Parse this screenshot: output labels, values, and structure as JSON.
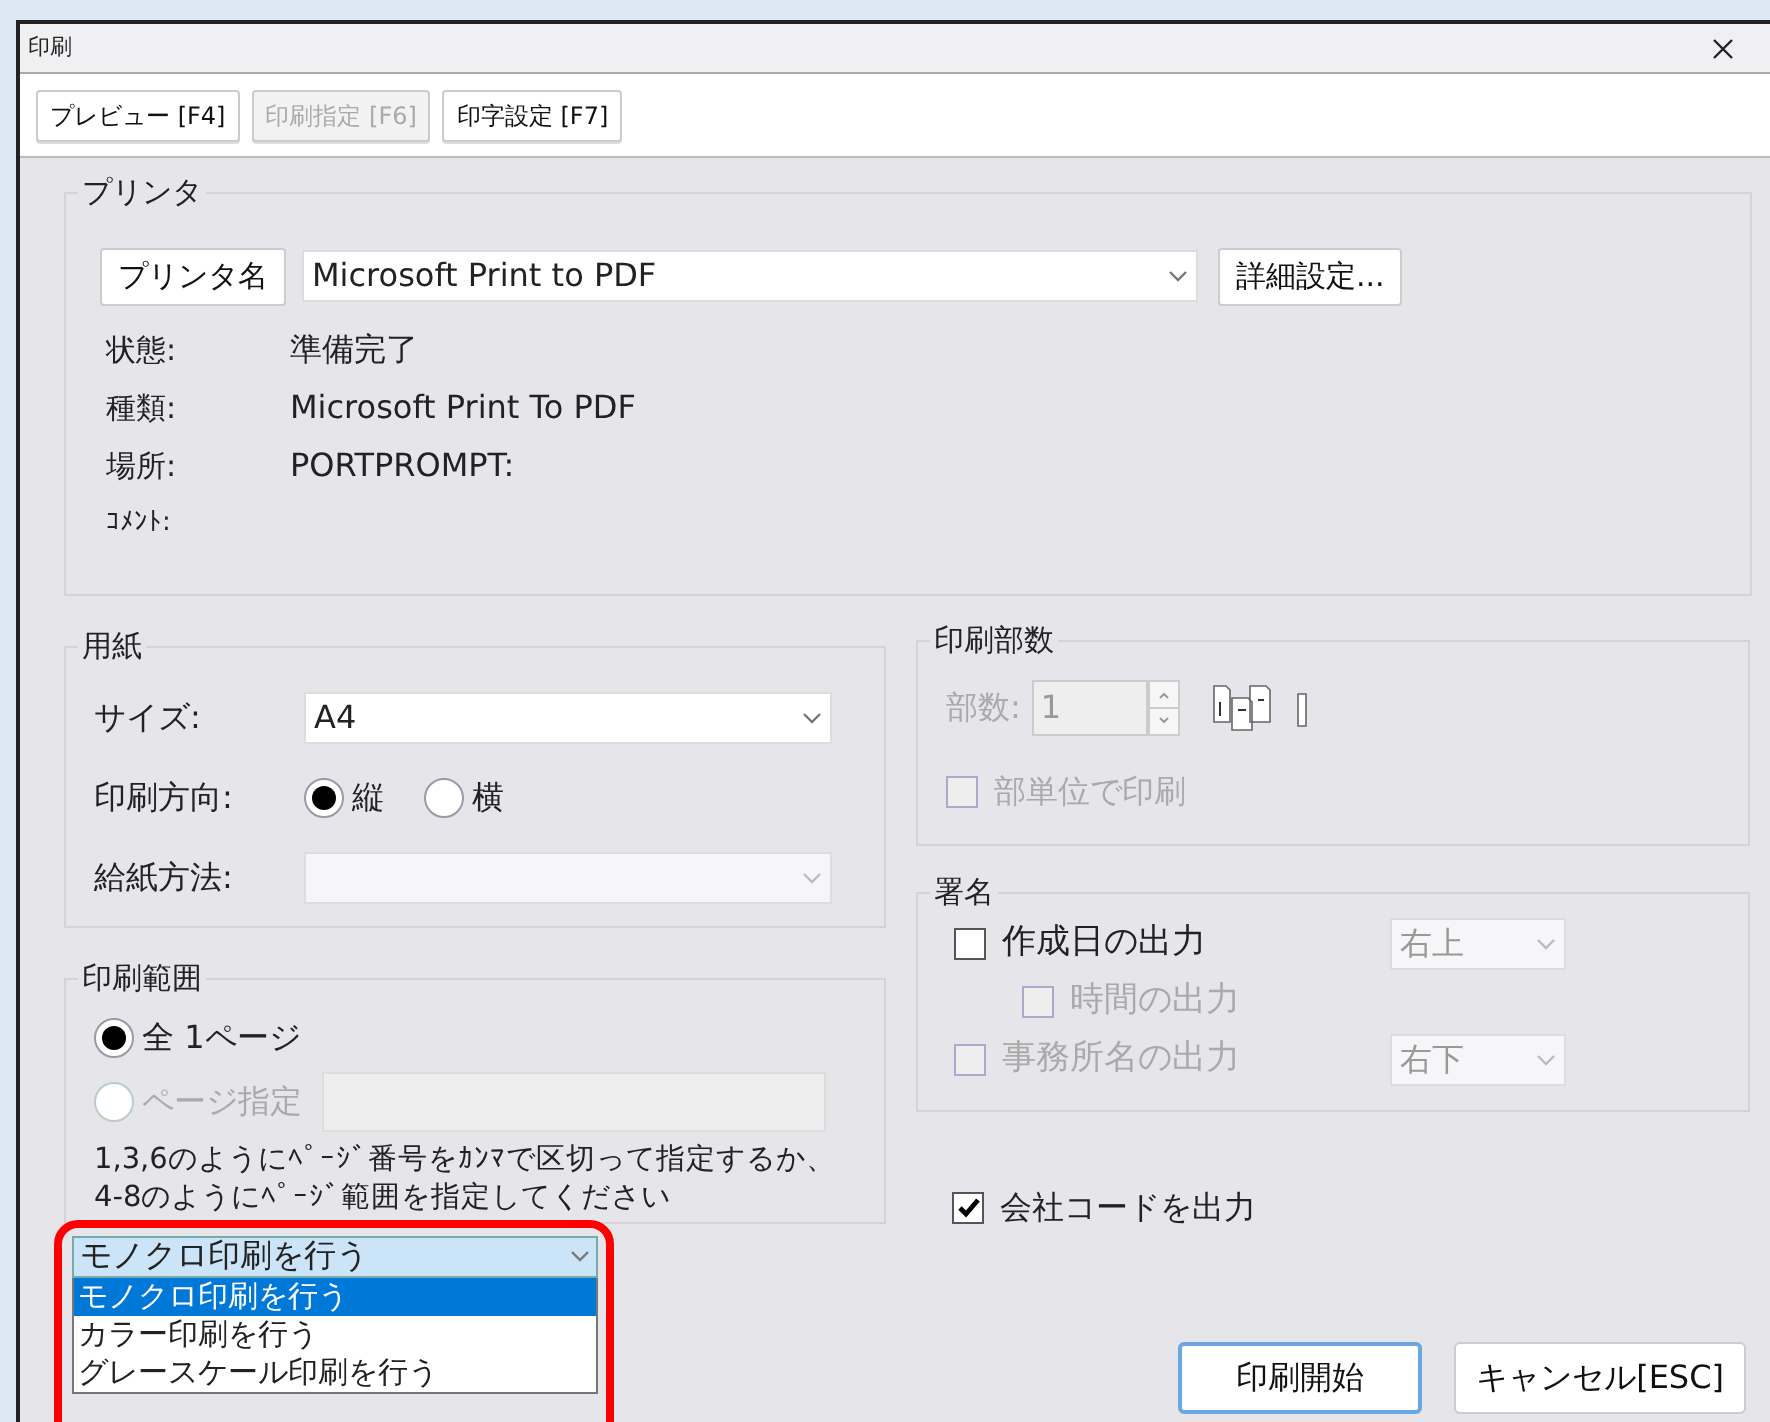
{
  "window": {
    "title": "印刷"
  },
  "toolbar": [
    {
      "label": "プレビュー [F4]",
      "disabled": false
    },
    {
      "label": "印刷指定 [F6]",
      "disabled": true
    },
    {
      "label": "印字設定 [F7]",
      "disabled": false
    }
  ],
  "printer": {
    "legend": "プリンタ",
    "name_button": "プリンタ名",
    "selected": "Microsoft Print to PDF",
    "details_button": "詳細設定...",
    "info": [
      {
        "label": "状態:",
        "value": "準備完了"
      },
      {
        "label": "種類:",
        "value": "Microsoft Print To PDF"
      },
      {
        "label": "場所:",
        "value": "PORTPROMPT:"
      },
      {
        "label": "ｺﾒﾝﾄ:"
      }
    ]
  },
  "paper": {
    "legend": "用紙",
    "size_label": "サイズ:",
    "size": "A4",
    "orientation_label": "印刷方向:",
    "orientations": [
      {
        "label": "縦",
        "selected": true
      },
      {
        "label": "横",
        "selected": false
      }
    ],
    "source_label": "給紙方法:"
  },
  "range": {
    "legend": "印刷範囲",
    "options": [
      {
        "label": "全 1ページ",
        "selected": true,
        "disabled": false
      },
      {
        "label": "ページ指定",
        "selected": false,
        "disabled": true
      }
    ],
    "hint": "1,3,6のようにﾍﾟｰｼﾞ番号をｶﾝﾏで区切って指定するか、4-8のようにﾍﾟｰｼﾞ範囲を指定してください"
  },
  "color_mode": {
    "value": "モノクロ印刷を行う",
    "expanded": true,
    "highlighted": true,
    "options": [
      {
        "label": "モノクロ印刷を行う",
        "selected": true
      },
      {
        "label": "カラー印刷を行う",
        "selected": false
      },
      {
        "label": "グレースケール印刷を行う",
        "selected": false
      }
    ]
  },
  "copies": {
    "legend": "印刷部数",
    "label": "部数:",
    "value": "1",
    "disabled": true,
    "collate": {
      "label": "部単位で印刷",
      "checked": false,
      "disabled": true
    }
  },
  "signature": {
    "legend": "署名",
    "items": [
      {
        "label": "作成日の出力",
        "checked": false,
        "disabled": false,
        "position": {
          "value": "右上",
          "disabled": true
        },
        "children": [
          {
            "label": "時間の出力",
            "checked": false,
            "disabled": true
          }
        ]
      },
      {
        "label": "事務所名の出力",
        "checked": false,
        "disabled": true,
        "position": {
          "value": "右下",
          "disabled": true
        }
      }
    ]
  },
  "company_code": {
    "label": "会社コードを出力",
    "checked": true
  },
  "buttons": [
    {
      "label": "印刷開始",
      "default": true
    },
    {
      "label": "キャンセル[ESC]",
      "default": false
    }
  ]
}
